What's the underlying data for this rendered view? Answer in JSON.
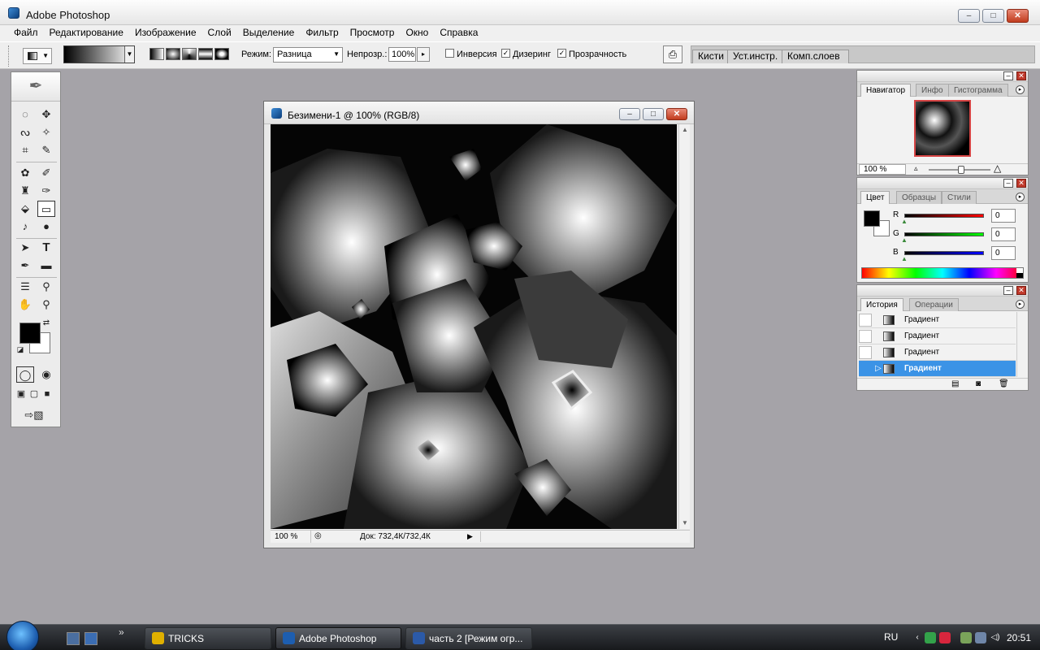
{
  "window": {
    "title": "Adobe Photoshop",
    "minimize": "–",
    "restore": "□",
    "close": "✕"
  },
  "menu": [
    "Файл",
    "Редактирование",
    "Изображение",
    "Слой",
    "Выделение",
    "Фильтр",
    "Просмотр",
    "Окно",
    "Справка"
  ],
  "options": {
    "mode_label": "Режим:",
    "mode_value": "Разница",
    "opacity_label": "Непрозр.:",
    "opacity_value": "100%",
    "reverse_label": "Инверсия",
    "reverse_checked": false,
    "dither_label": "Дизеринг",
    "dither_checked": true,
    "transparency_label": "Прозрачность",
    "transparency_checked": true,
    "well_tabs": [
      "Кисти",
      "Уст.инстр.",
      "Комп.слоев"
    ]
  },
  "document": {
    "title": "Безимени-1 @ 100% (RGB/8)",
    "zoom": "100 %",
    "info": "Док: 732,4К/732,4К"
  },
  "navigator": {
    "tabs": [
      "Навигатор",
      "Инфо",
      "Гистограмма"
    ],
    "zoom": "100 %"
  },
  "color": {
    "tabs": [
      "Цвет",
      "Образцы",
      "Стили"
    ],
    "channels": [
      {
        "label": "R",
        "value": "0",
        "bar": "linear-gradient(90deg,#000,#f00)"
      },
      {
        "label": "G",
        "value": "0",
        "bar": "linear-gradient(90deg,#000,#0f0)"
      },
      {
        "label": "B",
        "value": "0",
        "bar": "linear-gradient(90deg,#000,#00f)"
      }
    ]
  },
  "history": {
    "tabs": [
      "История",
      "Операции"
    ],
    "items": [
      "Градиент",
      "Градиент",
      "Градиент",
      "Градиент"
    ],
    "active_index": 3
  },
  "taskbar": {
    "tasks": [
      {
        "label": "TRICKS",
        "icon_color": "#e0b000"
      },
      {
        "label": "Adobe Photoshop",
        "icon_color": "#1d5eb0"
      },
      {
        "label": "часть 2 [Режим огр...",
        "icon_color": "#2b5aa8"
      }
    ],
    "lang": "RU",
    "clock": "20:51"
  },
  "colors": {
    "accent": "#3b93e6",
    "canvas_bg": "#050505",
    "close_red": "#c13c1e"
  }
}
